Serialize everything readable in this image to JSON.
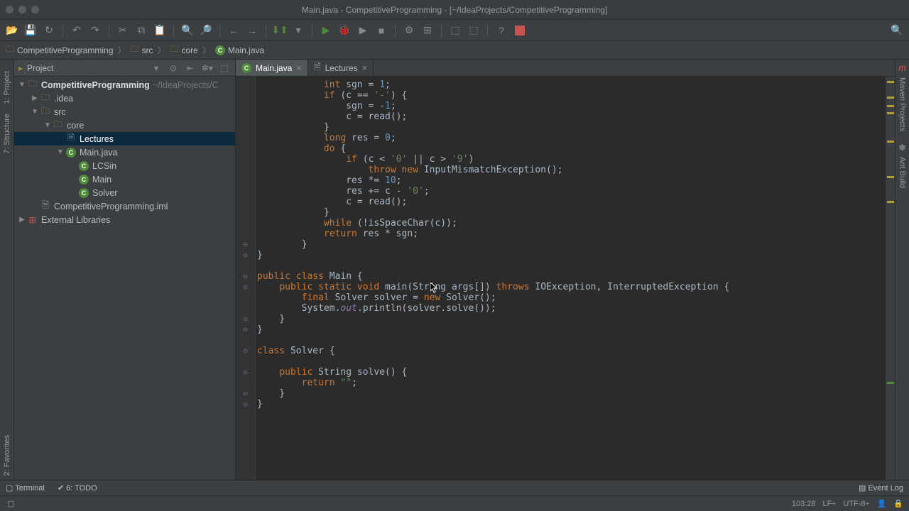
{
  "window": {
    "title": "Main.java - CompetitiveProgramming - [~/IdeaProjects/CompetitiveProgramming]"
  },
  "breadcrumbs": {
    "items": [
      {
        "label": "CompetitiveProgramming",
        "icon": "folder"
      },
      {
        "label": "src",
        "icon": "folder"
      },
      {
        "label": "core",
        "icon": "folder"
      },
      {
        "label": "Main.java",
        "icon": "class"
      }
    ]
  },
  "project_panel": {
    "title": "Project",
    "tree": [
      {
        "indent": 0,
        "arrow": "▼",
        "icon": "folder",
        "label": "CompetitiveProgramming",
        "suffix": " ~/IdeaProjects/C",
        "bold": true
      },
      {
        "indent": 1,
        "arrow": "▶",
        "icon": "folder",
        "label": ".idea"
      },
      {
        "indent": 1,
        "arrow": "▼",
        "icon": "folder",
        "label": "src"
      },
      {
        "indent": 2,
        "arrow": "▼",
        "icon": "folder",
        "label": "core"
      },
      {
        "indent": 3,
        "arrow": "",
        "icon": "file",
        "label": "Lectures",
        "selected": true
      },
      {
        "indent": 3,
        "arrow": "▼",
        "icon": "class",
        "label": "Main.java"
      },
      {
        "indent": 4,
        "arrow": "",
        "icon": "class",
        "label": "LCSin"
      },
      {
        "indent": 4,
        "arrow": "",
        "icon": "class",
        "label": "Main"
      },
      {
        "indent": 4,
        "arrow": "",
        "icon": "class",
        "label": "Solver"
      },
      {
        "indent": 1,
        "arrow": "",
        "icon": "file",
        "label": "CompetitiveProgramming.iml"
      },
      {
        "indent": 0,
        "arrow": "▶",
        "icon": "lib",
        "label": "External Libraries"
      }
    ]
  },
  "editor": {
    "tabs": [
      {
        "label": "Main.java",
        "icon": "class",
        "active": true
      },
      {
        "label": "Lectures",
        "icon": "file",
        "active": false
      }
    ],
    "code_lines": [
      {
        "i": "            ",
        "t": [
          [
            "kw",
            "int"
          ],
          [
            "",
            " sgn = "
          ],
          [
            "num",
            "1"
          ],
          [
            "",
            ";"
          ]
        ]
      },
      {
        "i": "            ",
        "t": [
          [
            "kw",
            "if"
          ],
          [
            "",
            " (c == "
          ],
          [
            "str",
            "'-'"
          ],
          [
            "",
            ") {"
          ]
        ]
      },
      {
        "i": "                ",
        "t": [
          [
            "",
            "sgn = -"
          ],
          [
            "num",
            "1"
          ],
          [
            "",
            ";"
          ]
        ]
      },
      {
        "i": "                ",
        "t": [
          [
            "",
            "c = read();"
          ]
        ]
      },
      {
        "i": "            ",
        "t": [
          [
            "",
            "}"
          ]
        ]
      },
      {
        "i": "            ",
        "t": [
          [
            "kw",
            "long"
          ],
          [
            "",
            " res = "
          ],
          [
            "num",
            "0"
          ],
          [
            "",
            ";"
          ]
        ]
      },
      {
        "i": "            ",
        "t": [
          [
            "kw",
            "do"
          ],
          [
            "",
            " {"
          ]
        ]
      },
      {
        "i": "                ",
        "t": [
          [
            "kw",
            "if"
          ],
          [
            "",
            " (c < "
          ],
          [
            "str",
            "'0'"
          ],
          [
            "",
            " || c > "
          ],
          [
            "str",
            "'9'"
          ],
          [
            "",
            ")"
          ]
        ]
      },
      {
        "i": "                    ",
        "t": [
          [
            "kw",
            "throw new"
          ],
          [
            "",
            " InputMismatchException();"
          ]
        ]
      },
      {
        "i": "                ",
        "t": [
          [
            "",
            "res *= "
          ],
          [
            "num",
            "10"
          ],
          [
            "",
            ";"
          ]
        ]
      },
      {
        "i": "                ",
        "t": [
          [
            "",
            "res += c - "
          ],
          [
            "str",
            "'0'"
          ],
          [
            "",
            ";"
          ]
        ]
      },
      {
        "i": "                ",
        "t": [
          [
            "",
            "c = read();"
          ]
        ]
      },
      {
        "i": "            ",
        "t": [
          [
            "",
            "}"
          ]
        ]
      },
      {
        "i": "            ",
        "t": [
          [
            "kw",
            "while"
          ],
          [
            "",
            " (!isSpaceChar(c));"
          ]
        ]
      },
      {
        "i": "            ",
        "t": [
          [
            "kw",
            "return"
          ],
          [
            "",
            " res * sgn;"
          ]
        ]
      },
      {
        "i": "        ",
        "t": [
          [
            "",
            "}"
          ]
        ]
      },
      {
        "i": "",
        "t": [
          [
            "",
            "}"
          ]
        ]
      },
      {
        "i": "",
        "t": []
      },
      {
        "i": "",
        "t": [
          [
            "kw",
            "public class"
          ],
          [
            "",
            " Main {"
          ]
        ]
      },
      {
        "i": "    ",
        "t": [
          [
            "kw",
            "public static void"
          ],
          [
            "",
            " main(String args[]) "
          ],
          [
            "kw",
            "throws"
          ],
          [
            "",
            " IOException, InterruptedException {"
          ]
        ]
      },
      {
        "i": "        ",
        "t": [
          [
            "kw",
            "final"
          ],
          [
            "",
            " Solver solver = "
          ],
          [
            "kw",
            "new"
          ],
          [
            "",
            " Solver();"
          ]
        ]
      },
      {
        "i": "        ",
        "t": [
          [
            "",
            "System."
          ],
          [
            "field",
            "out"
          ],
          [
            "",
            ".println(solver.solve());"
          ]
        ]
      },
      {
        "i": "    ",
        "t": [
          [
            "",
            "}"
          ]
        ]
      },
      {
        "i": "",
        "t": [
          [
            "",
            "}"
          ]
        ]
      },
      {
        "i": "",
        "t": []
      },
      {
        "i": "",
        "t": [
          [
            "kw",
            "class"
          ],
          [
            "",
            " Solver {"
          ]
        ]
      },
      {
        "i": "",
        "t": []
      },
      {
        "i": "    ",
        "t": [
          [
            "kw",
            "public"
          ],
          [
            "",
            " String solve() {"
          ]
        ]
      },
      {
        "i": "        ",
        "t": [
          [
            "kw",
            "return"
          ],
          [
            "",
            " "
          ],
          [
            "str",
            "\"\""
          ],
          [
            "",
            ";"
          ]
        ]
      },
      {
        "i": "    ",
        "t": [
          [
            "",
            "}"
          ]
        ]
      },
      {
        "i": "",
        "t": [
          [
            "",
            "}"
          ]
        ]
      }
    ]
  },
  "left_tabs": [
    "1: Project",
    "7: Structure"
  ],
  "left_bottom_tabs": [
    "2: Favorites"
  ],
  "right_tabs_top": "m",
  "right_tabs": [
    "Maven Projects",
    "Ant Build"
  ],
  "bottom_tools": {
    "terminal": "Terminal",
    "todo": "6: TODO",
    "event_log": "Event Log"
  },
  "status": {
    "pos": "103:28",
    "lf": "LF÷",
    "enc": "UTF-8÷"
  }
}
